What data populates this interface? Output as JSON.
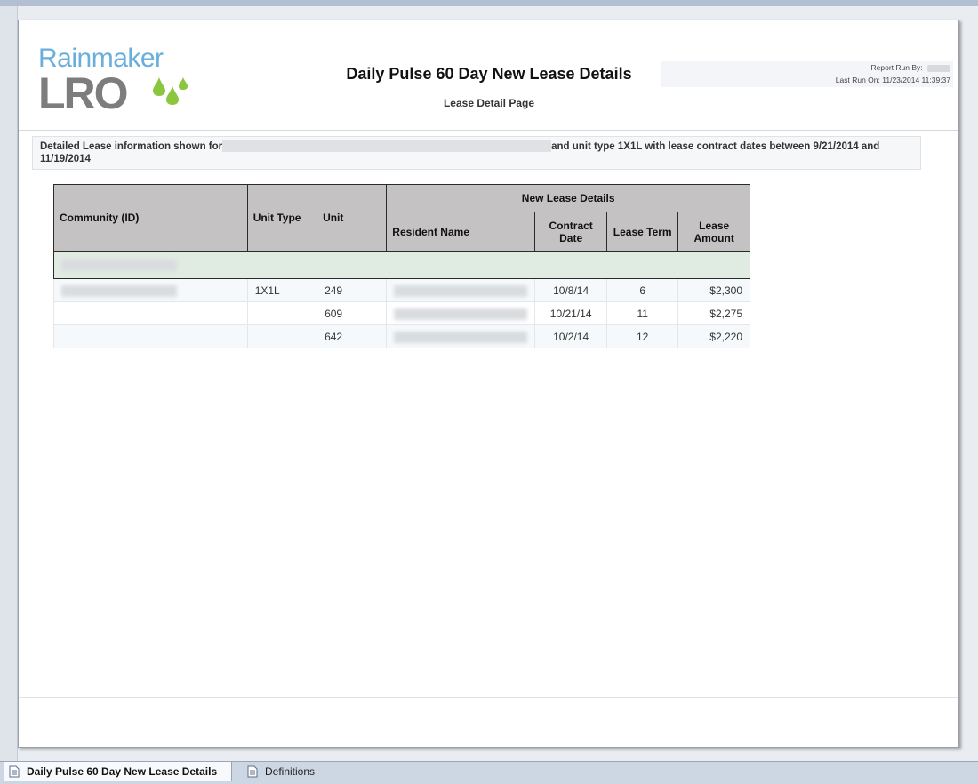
{
  "report": {
    "logo_top": "Rainmaker",
    "logo_bottom": "LRO",
    "title": "Daily Pulse 60 Day New Lease Details",
    "subtitle": "Lease Detail Page",
    "run_by_label": "Report Run By:",
    "run_by_value": "",
    "last_run_label": "Last Run On:",
    "last_run_value": "11/23/2014 11:39:37"
  },
  "info": {
    "prefix": "Detailed Lease information shown for",
    "suffix": "and unit type 1X1L with lease contract dates between 9/21/2014 and 11/19/2014"
  },
  "table": {
    "headers": {
      "community": "Community (ID)",
      "unit_type": "Unit Type",
      "unit": "Unit",
      "group": "New Lease Details",
      "resident": "Resident Name",
      "contract": "Contract Date",
      "term": "Lease Term",
      "amount": "Lease Amount"
    },
    "rows": [
      {
        "unit_type": "1X1L",
        "unit": "249",
        "contract": "10/8/14",
        "term": "6",
        "amount": "$2,300"
      },
      {
        "unit_type": "",
        "unit": "609",
        "contract": "10/21/14",
        "term": "11",
        "amount": "$2,275"
      },
      {
        "unit_type": "",
        "unit": "642",
        "contract": "10/2/14",
        "term": "12",
        "amount": "$2,220"
      }
    ]
  },
  "tabs": [
    {
      "label": "Daily Pulse 60 Day New Lease Details"
    },
    {
      "label": "Definitions"
    }
  ]
}
